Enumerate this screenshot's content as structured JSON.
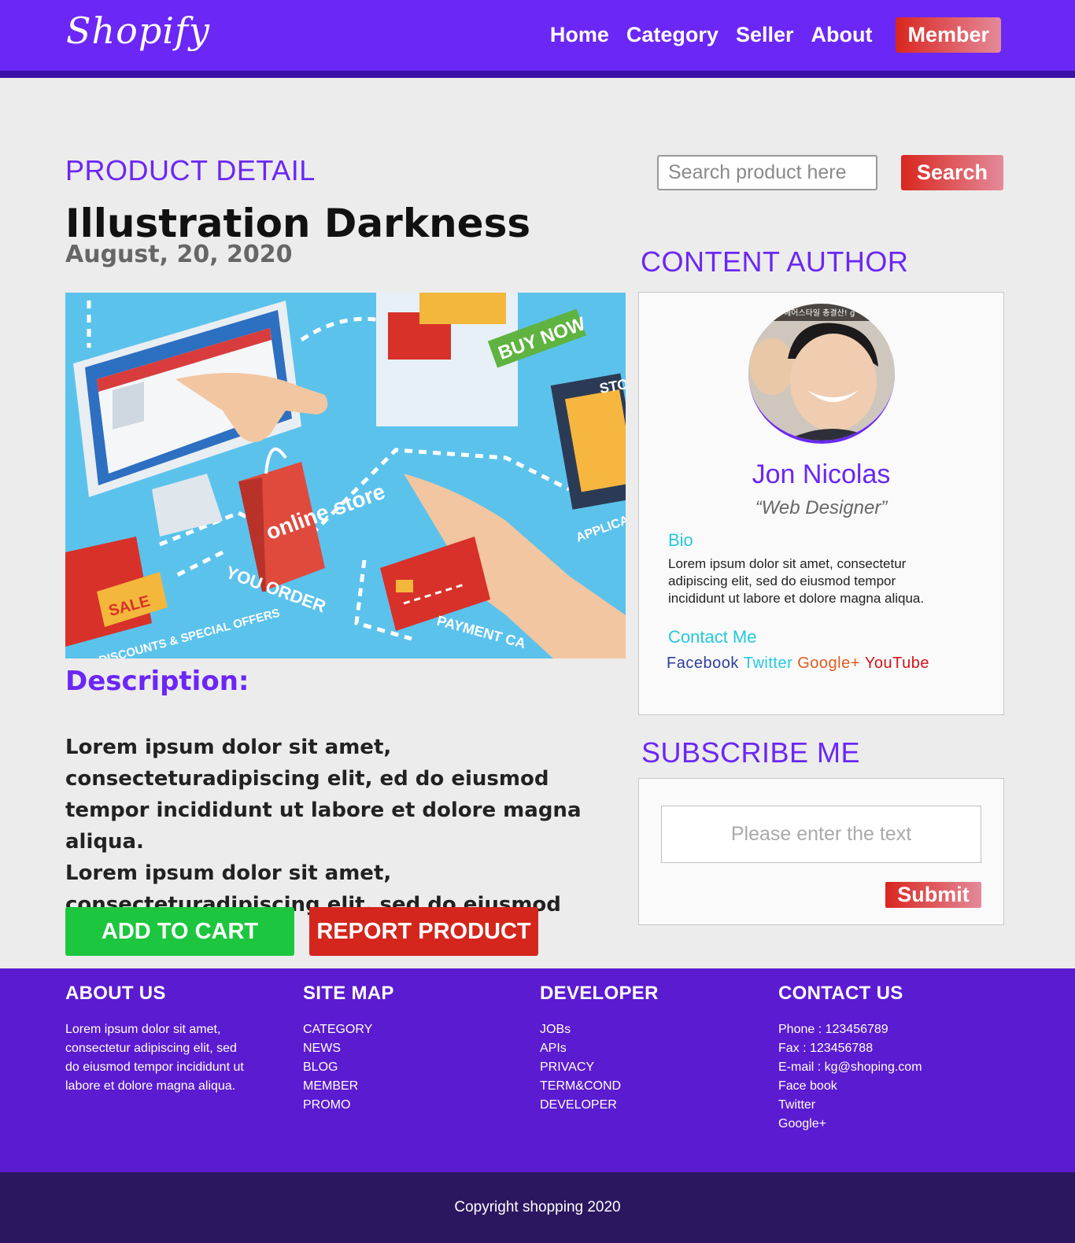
{
  "header": {
    "logo": "Shopify",
    "nav": [
      "Home",
      "Category",
      "Seller",
      "About"
    ],
    "member_label": "Member"
  },
  "product": {
    "section_label": "PRODUCT DETAIL",
    "title": "Illustration Darkness",
    "date": "August, 20, 2020",
    "image_texts": {
      "buy_now": "BUY NOW",
      "online_store": "online store",
      "you_order": "YOU ORDER",
      "sale": "SALE",
      "discounts": "DISCOUNTS & SPECIAL OFFERS",
      "payment": "PAYMENT CA",
      "store": "STOR",
      "applica": "APPLICA & BOOK"
    },
    "description_label": "Description:",
    "description": [
      "Lorem ipsum dolor sit amet, consecteturadipiscing elit, ed do eiusmod tempor incididunt ut labore et dolore magna aliqua.",
      "Lorem ipsum dolor sit amet, consecteturadipiscing elit, sed do eiusmod tempor."
    ],
    "add_to_cart": "ADD TO CART",
    "report": "REPORT PRODUCT"
  },
  "search": {
    "placeholder": "Search product here",
    "button": "Search"
  },
  "author": {
    "section_label": "CONTENT AUTHOR",
    "avatar_caption": "헤어스타일 총결산! g",
    "name": "Jon Nicolas",
    "role": "“Web Designer”",
    "bio_label": "Bio",
    "bio": "Lorem ipsum dolor sit amet, consectetur adipiscing elit, sed do eiusmod tempor incididunt ut labore et dolore magna aliqua.",
    "contact_label": "Contact Me",
    "social": {
      "facebook": "Facebook",
      "twitter": "Twitter",
      "googleplus": "Google+",
      "youtube": "YouTube"
    }
  },
  "subscribe": {
    "section_label": "SUBSCRIBE ME",
    "placeholder": "Please enter the text",
    "button": "Submit"
  },
  "footer": {
    "about": {
      "title": "ABOUT US",
      "text": "Lorem ipsum dolor sit amet, consectetur adipiscing elit, sed do eiusmod tempor incididunt ut labore et dolore magna aliqua."
    },
    "sitemap": {
      "title": "SITE MAP",
      "links": [
        "CATEGORY",
        "NEWS",
        "BLOG",
        "MEMBER",
        "PROMO"
      ]
    },
    "developer": {
      "title": "DEVELOPER",
      "links": [
        "JOBs",
        "APIs",
        "PRIVACY",
        "TERM&COND",
        "DEVELOPER"
      ]
    },
    "contact": {
      "title": "CONTACT US",
      "lines": [
        "Phone : 123456789",
        "Fax : 123456788",
        "E-mail : kg@shoping.com",
        "Face book",
        "Twitter",
        "Google+"
      ]
    },
    "copyright": "Copyright shopping 2020"
  },
  "colors": {
    "brand": "#6b27f5",
    "footer": "#5b1bd0",
    "copyright_bar": "#2b1760",
    "add_to_cart": "#1dc63f",
    "report": "#d4261c",
    "accent_cyan": "#24c9de"
  }
}
